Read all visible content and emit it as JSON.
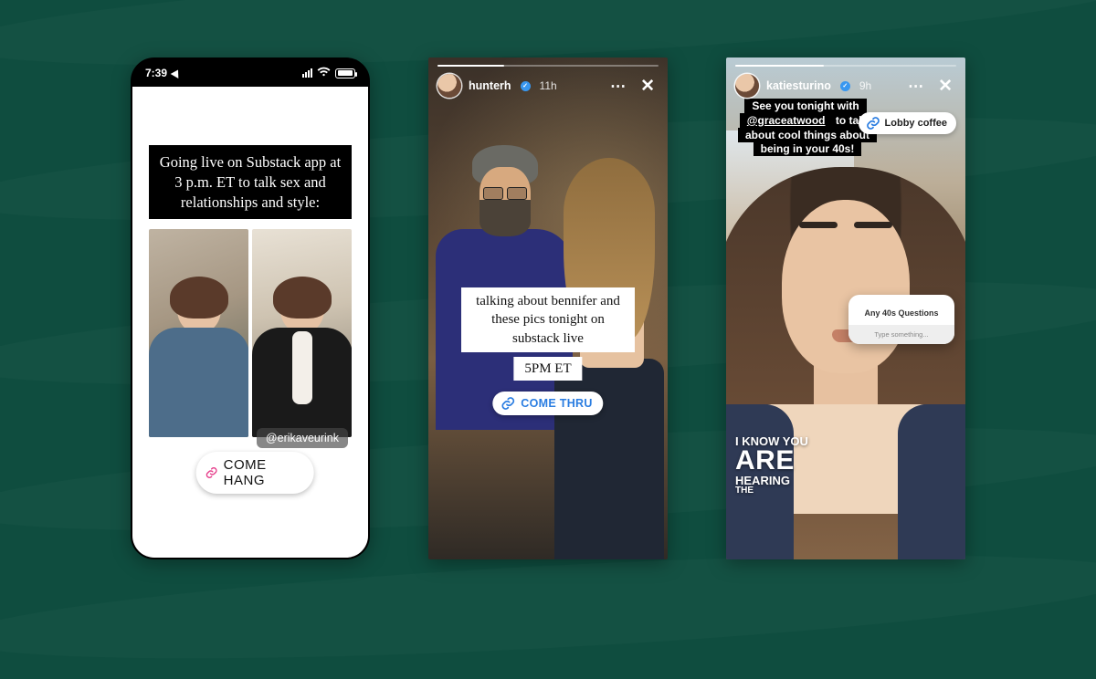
{
  "colors": {
    "bg": "#0f4d3f",
    "linkBlue": "#2a7de1",
    "igBlue": "#3897f0"
  },
  "p1": {
    "status_time": "7:39",
    "headline": "Going live on Substack app at 3 p.m. ET to talk sex and relationships and style:",
    "mention": "@erikaveurink",
    "link_label": "COME HANG"
  },
  "p2": {
    "username": "hunterh",
    "age": "11h",
    "progress_pct": 30,
    "caption_main": "talking about bennifer and these pics tonight on substack live",
    "caption_time": "5PM ET",
    "link_label": "COME THRU"
  },
  "p3": {
    "username": "katiesturino",
    "age": "9h",
    "progress_pct": 40,
    "banner_pre": "See you tonight with ",
    "banner_mention": "@graceatwood",
    "banner_post": " to talk about cool things about being in your 40s!",
    "link_label": "Lobby coffee",
    "question_title": "Any 40s Questions",
    "question_placeholder": "Type something...",
    "caption_l1": "I KNOW YOU",
    "caption_l2": "ARE",
    "caption_l3": "HEARING",
    "caption_l4": "THE"
  }
}
